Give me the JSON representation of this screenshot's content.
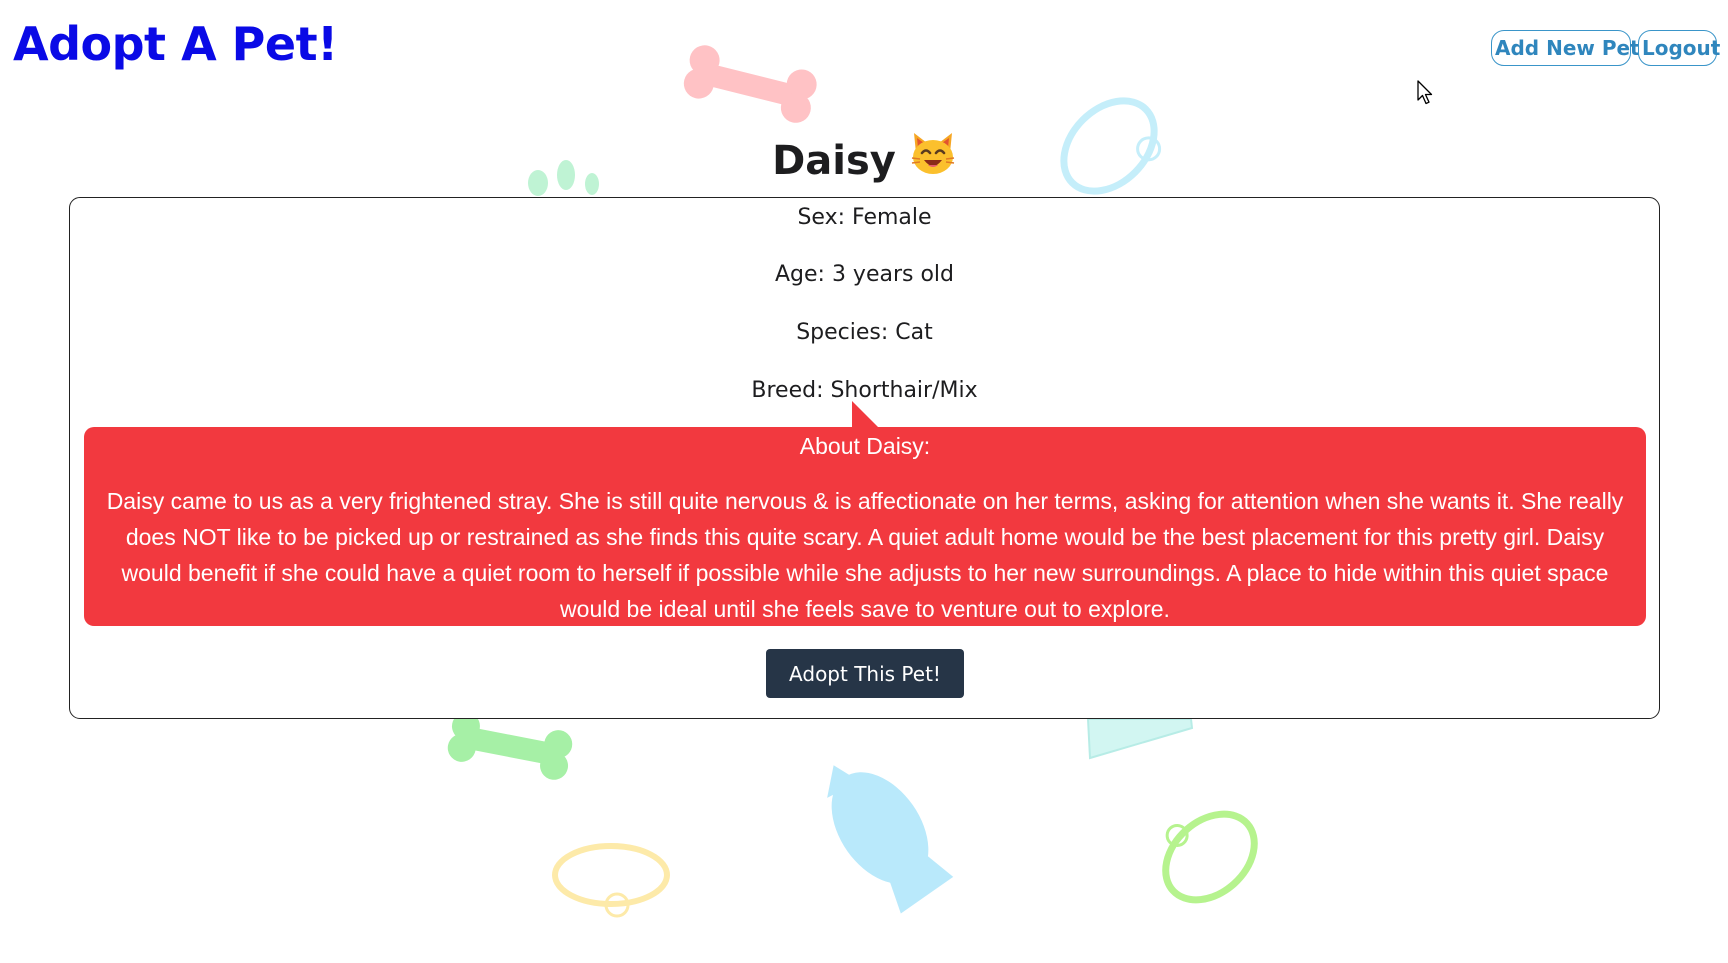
{
  "header": {
    "app_title": "Adopt A Pet!",
    "nav": {
      "add_new_pet": "Add New Pet",
      "logout": "Logout"
    }
  },
  "pet": {
    "name": "Daisy",
    "icon": "cat-face-icon",
    "sex": "Sex: Female",
    "age": "Age: 3 years old",
    "species": "Species: Cat",
    "breed": "Breed: Shorthair/Mix",
    "about_title": "About Daisy:",
    "about_text": "Daisy came to us as a very frightened stray. She is still quite nervous & is affectionate on her terms, asking for attention when she wants it. She really does NOT like to be picked up or restrained as she finds this quite scary. A quiet adult home would be the best placement for this pretty girl. Daisy would benefit if she could have a quiet room to herself if possible while she adjusts to her new surroundings. A place to hide within this quiet space would be ideal until she feels save to venture out to explore.",
    "adopt_button": "Adopt This Pet!"
  },
  "colors": {
    "title": "#0a0ae6",
    "nav_button": "#2f86bd",
    "about_background": "#f2393f",
    "adopt_button": "#263547"
  },
  "decor_icons": [
    "bone-icon",
    "paw-icon",
    "collar-icon",
    "fish-icon",
    "bowl-icon"
  ]
}
